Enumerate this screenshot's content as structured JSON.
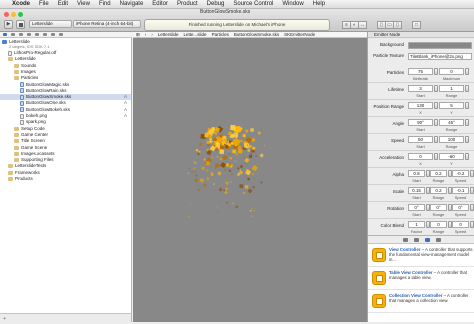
{
  "menubar": {
    "app_name": "Xcode",
    "items": [
      "File",
      "Edit",
      "View",
      "Find",
      "Navigate",
      "Editor",
      "Product",
      "Debug",
      "Source Control",
      "Window",
      "Help"
    ]
  },
  "window_title": "ButtonGlowSmoke.sks",
  "toolbar": {
    "scheme": "Letterslide",
    "destination": "iPhone Retina (4-inch 64-bit)",
    "status": "Finished running Letterslide on Michael's iPhone",
    "traffic_light_colors": [
      "#ff5f57",
      "#ffbd2e",
      "#28c940"
    ]
  },
  "jumpbar": {
    "crumbs": [
      "Letterslide",
      "Lette...slide",
      "Particles",
      "ButtonGlowSmoke.sks",
      "SKEmitterNode"
    ]
  },
  "navigator": {
    "project": {
      "name": "Letterslide",
      "subtitle": "2 targets, iOS SDK 7.1"
    },
    "items": [
      {
        "label": "LithosPro-Regular.otf",
        "indent": 1,
        "kind": "file"
      },
      {
        "label": "Letterslide",
        "indent": 1,
        "kind": "folder"
      },
      {
        "label": "Sounds",
        "indent": 2,
        "kind": "folder"
      },
      {
        "label": "Images",
        "indent": 2,
        "kind": "folder"
      },
      {
        "label": "Particles",
        "indent": 2,
        "kind": "folder"
      },
      {
        "label": "ButtonGlowMagic.sks",
        "indent": 3,
        "kind": "sks"
      },
      {
        "label": "ButtonGlowRain.sks",
        "indent": 3,
        "kind": "sks"
      },
      {
        "label": "ButtonGlowSmoke.sks",
        "indent": 3,
        "kind": "sks",
        "selected": true,
        "badge": "A"
      },
      {
        "label": "ButtonGlowOne.sks",
        "indent": 3,
        "kind": "sks",
        "badge": "A"
      },
      {
        "label": "ButtonGlowBokeh.sks",
        "indent": 3,
        "kind": "sks",
        "badge": "A"
      },
      {
        "label": "bokeh.png",
        "indent": 3,
        "kind": "file",
        "badge": "A"
      },
      {
        "label": "spark.png",
        "indent": 3,
        "kind": "file"
      },
      {
        "label": "Setup Code",
        "indent": 2,
        "kind": "folder"
      },
      {
        "label": "Game Center",
        "indent": 2,
        "kind": "folder"
      },
      {
        "label": "Title Screen",
        "indent": 2,
        "kind": "folder"
      },
      {
        "label": "Game Scene",
        "indent": 2,
        "kind": "folder"
      },
      {
        "label": "Images.xcassets",
        "indent": 2,
        "kind": "folder"
      },
      {
        "label": "Supporting Files",
        "indent": 2,
        "kind": "folder"
      },
      {
        "label": "LetterslideTests",
        "indent": 1,
        "kind": "folder"
      },
      {
        "label": "Frameworks",
        "indent": 1,
        "kind": "folder"
      },
      {
        "label": "Products",
        "indent": 1,
        "kind": "folder"
      }
    ]
  },
  "inspector": {
    "header": "Emitter Node",
    "background_label": "Background",
    "texture_label": "Particle Texture",
    "texture_value": "TileBlank_iPhone@2x.png",
    "rows": [
      {
        "label": "Particles",
        "a": "75",
        "b": "0",
        "a_sub": "Birthrate",
        "b_sub": "Maximum"
      },
      {
        "label": "Lifetime",
        "a": "3",
        "b": "1",
        "a_sub": "Start",
        "b_sub": "Range"
      },
      {
        "label": "Position Range",
        "a": "130",
        "b": "5",
        "a_sub": "X",
        "b_sub": "Y"
      },
      {
        "label": "Angle",
        "a": "90°",
        "b": "45°",
        "a_sub": "Start",
        "b_sub": "Range"
      },
      {
        "label": "Speed",
        "a": "50",
        "b": "100",
        "a_sub": "Start",
        "b_sub": "Range"
      },
      {
        "label": "Acceleration",
        "a": "0",
        "b": "-60",
        "a_sub": "X",
        "b_sub": "Y"
      },
      {
        "label": "Alpha",
        "a": "0.8",
        "b": "0.2",
        "c": "-0.2",
        "a_sub": "Start",
        "b_sub": "Range",
        "c_sub": "Speed"
      },
      {
        "label": "Scale",
        "a": "0.15",
        "b": "0.2",
        "c": "-0.1",
        "a_sub": "Start",
        "b_sub": "Range",
        "c_sub": "Speed"
      },
      {
        "label": "Rotation",
        "a": "0°",
        "b": "0°",
        "c": "0°",
        "a_sub": "Start",
        "b_sub": "Range",
        "c_sub": "Speed"
      }
    ],
    "color_blend": {
      "label": "Color Blend",
      "a": "1",
      "b": "0",
      "c": "0",
      "a_sub": "Factor",
      "b_sub": "Range",
      "c_sub": "Speed"
    }
  },
  "library": {
    "items": [
      {
        "title": "View Controller",
        "desc": "A controller that supports the fundamental view-management model in..."
      },
      {
        "title": "Table View Controller",
        "desc": "A controller that manages a table view."
      },
      {
        "title": "Collection View Controller",
        "desc": "A controller that manages a collection view."
      }
    ]
  },
  "colors": {
    "canvas_bg": "#888888",
    "particle_colors": [
      "#f0a400",
      "#ffb90a",
      "#b96c00",
      "#ffce3a",
      "#8a4e00"
    ],
    "selection": "#d0dbed"
  },
  "particles": {
    "count": 180,
    "seed": 7
  }
}
